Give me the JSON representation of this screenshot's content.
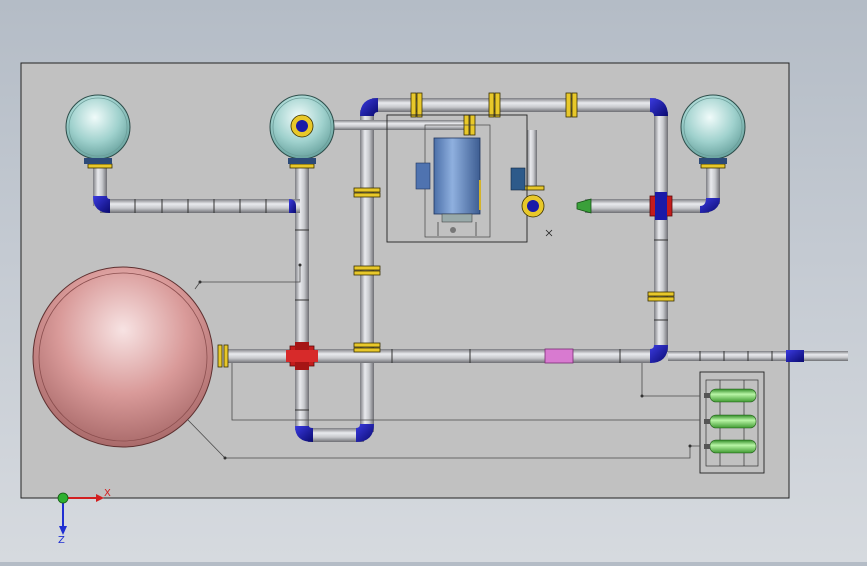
{
  "axis_triad": {
    "x_label": "X",
    "z_label": "Z"
  },
  "colors": {
    "background_top": "#b4bcc6",
    "plate": "#c1c1c1",
    "pipe": "#bdbec2",
    "elbow": "#1a1aa8",
    "tee": "#c41c1c",
    "flange": "#e8c82a",
    "sphere_tank": "#d99a99",
    "small_tank": "#9fd1cd",
    "gas_cylinder": "#6fd35a",
    "pink_section": "#d87ad0",
    "reducer": "#3aa03a",
    "skid": "#6d8fc2"
  },
  "icons": [
    "axis-triad-icon"
  ]
}
